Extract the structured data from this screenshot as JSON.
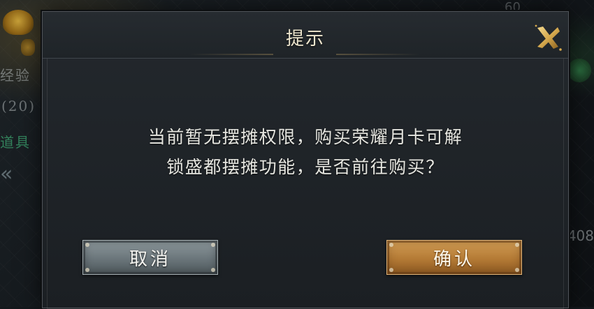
{
  "background": {
    "left_texts": [
      "经验",
      "(20)",
      "道具"
    ],
    "top_numbers": [
      "60"
    ],
    "right_number": "408"
  },
  "dialog": {
    "title": "提示",
    "message_lines": [
      "当前暂无摆摊权限，购买荣耀月卡可解",
      "锁盛都摆摊功能，是否前往购买？"
    ],
    "cancel_label": "取消",
    "confirm_label": "确认"
  },
  "colors": {
    "dialog_bg": "#1f2428",
    "title_text": "#efe7cf",
    "cancel_button": "#6a757a",
    "confirm_button": "#b47a35",
    "close_icon": "#d9b66a"
  },
  "icons": {
    "close": "close-x-icon",
    "back": "chevron-left-icon"
  }
}
